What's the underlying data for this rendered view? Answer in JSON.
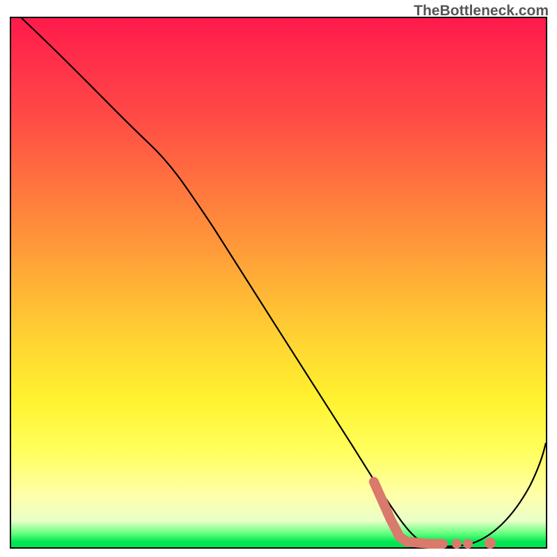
{
  "watermark": "TheBottleneck.com",
  "chart_data": {
    "type": "line",
    "title": "",
    "xlabel": "",
    "ylabel": "",
    "xlim": [
      0,
      100
    ],
    "ylim": [
      0,
      100
    ],
    "series": [
      {
        "name": "bottleneck-curve",
        "x": [
          2,
          10,
          20,
          25,
          30,
          40,
          50,
          60,
          65,
          68,
          72,
          76,
          80,
          84,
          88,
          92,
          96,
          100
        ],
        "y": [
          100,
          90,
          78,
          72,
          66,
          53,
          40,
          27,
          20,
          15,
          9,
          4,
          1,
          0,
          1,
          5,
          12,
          22
        ]
      }
    ],
    "annotations": [
      {
        "name": "pink-valley-start",
        "x": 65,
        "y": 15
      },
      {
        "name": "pink-valley-floor-start",
        "x": 68,
        "y": 1
      },
      {
        "name": "pink-valley-floor-end",
        "x": 78,
        "y": 0
      },
      {
        "name": "pink-dot-1",
        "x": 82,
        "y": 0
      },
      {
        "name": "pink-dot-2",
        "x": 86,
        "y": 0
      }
    ],
    "background_gradient": {
      "top": "#ff1a4b",
      "mid_upper": "#ff953a",
      "mid": "#fff22f",
      "mid_lower": "#ffffa8",
      "bottom": "#00e552"
    }
  }
}
